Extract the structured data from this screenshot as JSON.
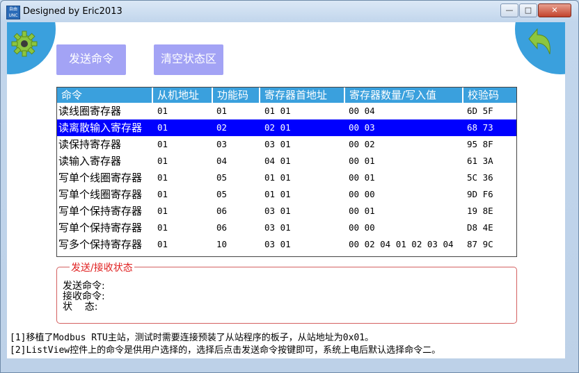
{
  "window": {
    "title": "Designed by Eric2013",
    "icon_text": "自由 UNC"
  },
  "toolbar": {
    "send_label": "发送命令",
    "clear_label": "清空状态区"
  },
  "table": {
    "headers": [
      "命令",
      "从机地址",
      "功能码",
      "寄存器首地址",
      "寄存器数量/写入值",
      "校验码"
    ],
    "rows": [
      [
        "读线圈寄存器",
        "01",
        "01",
        "01 01",
        "00 04",
        "6D 5F"
      ],
      [
        "读离散输入寄存器",
        "01",
        "02",
        "02 01",
        "00 03",
        "68 73"
      ],
      [
        "读保持寄存器",
        "01",
        "03",
        "03 01",
        "00 02",
        "95 8F"
      ],
      [
        "读输入寄存器",
        "01",
        "04",
        "04 01",
        "00 01",
        "61 3A"
      ],
      [
        "写单个线圈寄存器",
        "01",
        "05",
        "01 01",
        "00 01",
        "5C 36"
      ],
      [
        "写单个线圈寄存器",
        "01",
        "05",
        "01 01",
        "00 00",
        "9D F6"
      ],
      [
        "写单个保持寄存器",
        "01",
        "06",
        "03 01",
        "00 01",
        "19 8E"
      ],
      [
        "写单个保持寄存器",
        "01",
        "06",
        "03 01",
        "00 00",
        "D8 4E"
      ],
      [
        "写多个保持寄存器",
        "01",
        "10",
        "03 01",
        "00 02 04 01 02 03 04",
        "87 9C"
      ]
    ],
    "selected_index": 1
  },
  "status": {
    "legend": "发送/接收状态",
    "send_label": "发送命令:",
    "recv_label": "接收命令:",
    "state_label": "状    态:"
  },
  "notes": {
    "line1": "[1]移植了Modbus RTU主站，测试时需要连接预装了从站程序的板子，从站地址为0x01。",
    "line2": "[2]ListView控件上的命令是供用户选择的，选择后点击发送命令按键即可，系统上电后默认选择命令二。"
  },
  "colors": {
    "accent": "#3aa0dd",
    "button": "#a3a3f5",
    "selection": "#0000ff",
    "status_border": "#d46060",
    "legend_text": "#e02020"
  }
}
